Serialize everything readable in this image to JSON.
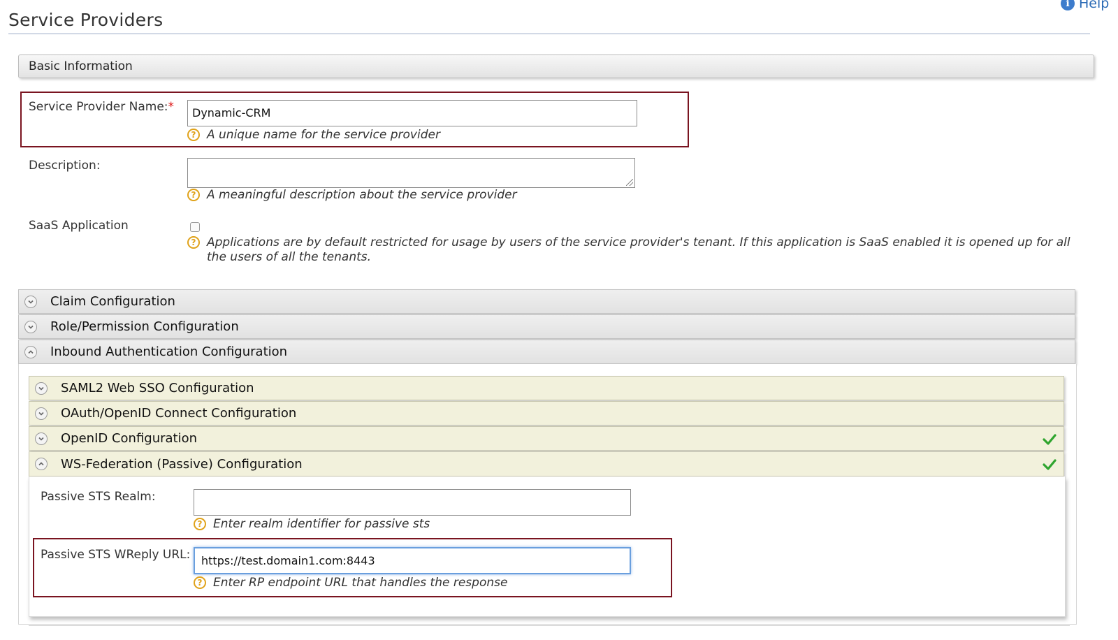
{
  "header": {
    "title": "Service Providers",
    "help_label": "Help"
  },
  "basic_info": {
    "section_title": "Basic Information",
    "sp_name_label": "Service Provider Name:",
    "sp_name_required": "*",
    "sp_name_value": "Dynamic-CRM",
    "sp_name_hint": "A unique name for the service provider",
    "description_label": "Description:",
    "description_value": "",
    "description_hint": "A meaningful description about the service provider",
    "saas_label": "SaaS Application",
    "saas_checked": false,
    "saas_hint": "Applications are by default restricted for usage by users of the service provider's tenant. If this application is SaaS enabled it is opened up for all the users of all the tenants."
  },
  "accordion": {
    "claim": "Claim Configuration",
    "role": "Role/Permission Configuration",
    "inbound": "Inbound Authentication Configuration"
  },
  "inbound": {
    "saml": "SAML2 Web SSO Configuration",
    "oauth": "OAuth/OpenID Connect Configuration",
    "openid": "OpenID Configuration",
    "wsfed": "WS-Federation (Passive) Configuration",
    "realm_label": "Passive STS Realm:",
    "realm_value": "",
    "realm_hint": "Enter realm identifier for passive sts",
    "wreply_label": "Passive STS WReply URL:",
    "wreply_value": "https://test.domain1.com:8443",
    "wreply_hint": "Enter RP endpoint URL that handles the response"
  },
  "icons": {
    "expand": "chevron-down-icon",
    "collapse": "chevron-up-icon",
    "help": "question-icon",
    "configured": "checkmark-icon",
    "info": "info-icon"
  },
  "colors": {
    "highlight_border": "#7a1420",
    "check_green": "#2fa52f",
    "hint_icon": "#e0a21a",
    "inner_bar": "#f2f1dc"
  }
}
